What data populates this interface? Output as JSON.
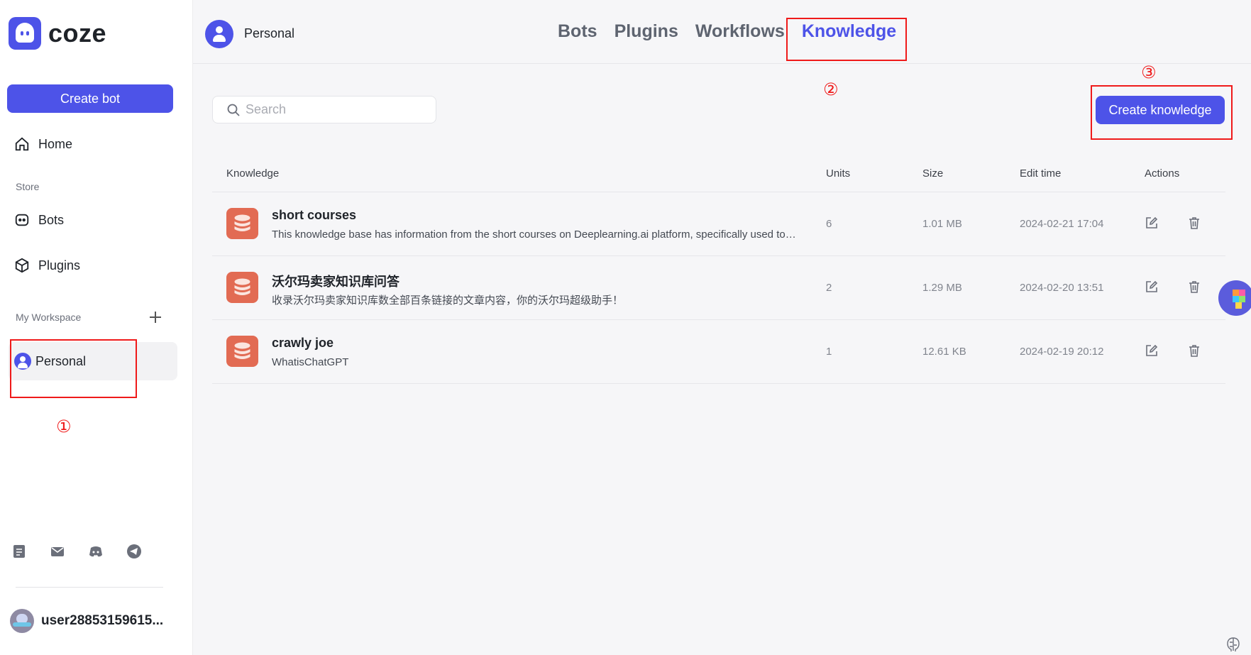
{
  "brand": {
    "name": "coze"
  },
  "sidebar": {
    "create_bot_label": "Create bot",
    "home_label": "Home",
    "store_label": "Store",
    "store_items": [
      {
        "label": "Bots",
        "icon": "bot-icon"
      },
      {
        "label": "Plugins",
        "icon": "cube-icon"
      }
    ],
    "workspace_label": "My Workspace",
    "workspace_item": "Personal",
    "footer_icons": [
      "document-icon",
      "mail-icon",
      "discord-icon",
      "telegram-icon"
    ],
    "user_name": "user28853159615..."
  },
  "header": {
    "space_name": "Personal",
    "tabs": [
      {
        "label": "Bots",
        "active": false
      },
      {
        "label": "Plugins",
        "active": false
      },
      {
        "label": "Workflows",
        "active": false
      },
      {
        "label": "Knowledge",
        "active": true
      }
    ]
  },
  "toolbar": {
    "search_placeholder": "Search",
    "create_knowledge_label": "Create knowledge"
  },
  "table": {
    "columns": [
      "Knowledge",
      "Units",
      "Size",
      "Edit time",
      "Actions"
    ],
    "rows": [
      {
        "title": "short courses",
        "description": "This knowledge base has information from the short courses on Deeplearning.ai platform, specifically used to a...",
        "units": "6",
        "size": "1.01 MB",
        "edit_time": "2024-02-21 17:04"
      },
      {
        "title": "沃尔玛卖家知识库问答",
        "description": "收录沃尔玛卖家知识库数全部百条链接的文章内容，你的沃尔玛超级助手！",
        "units": "2",
        "size": "1.29 MB",
        "edit_time": "2024-02-20 13:51"
      },
      {
        "title": "crawly joe",
        "description": "WhatisChatGPT",
        "units": "1",
        "size": "12.61 KB",
        "edit_time": "2024-02-19 20:12"
      }
    ]
  },
  "annotations": [
    "①",
    "②",
    "③"
  ],
  "colors": {
    "accent": "#4d53e8",
    "annotation": "#ef1a1a",
    "kb_icon": "#e26b53"
  }
}
